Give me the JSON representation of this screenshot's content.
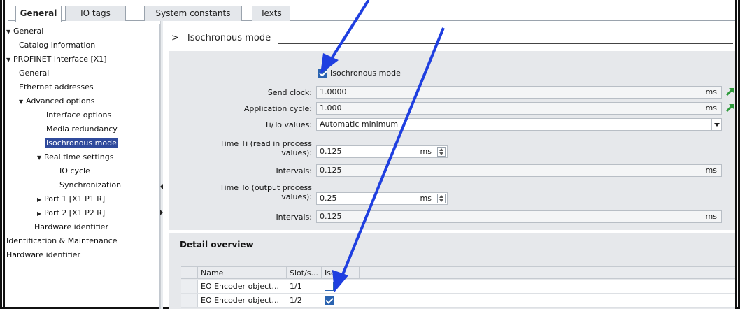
{
  "tabs": [
    {
      "label": "General",
      "active": true
    },
    {
      "label": "IO tags",
      "active": false
    },
    {
      "label": "System constants",
      "active": false
    },
    {
      "label": "Texts",
      "active": false
    }
  ],
  "nav": {
    "items": [
      {
        "label": "General",
        "expanded": true
      },
      {
        "label": "Catalog information"
      },
      {
        "label": "PROFINET interface [X1]",
        "expanded": true
      },
      {
        "label": "General"
      },
      {
        "label": "Ethernet addresses"
      },
      {
        "label": "Advanced options",
        "expanded": true
      },
      {
        "label": "Interface options"
      },
      {
        "label": "Media redundancy"
      },
      {
        "label": "Isochronous mode",
        "selected": true
      },
      {
        "label": "Real time settings",
        "expanded": true
      },
      {
        "label": "IO cycle"
      },
      {
        "label": "Synchronization"
      },
      {
        "label": "Port 1 [X1 P1 R]",
        "expanded": false
      },
      {
        "label": "Port 2 [X1 P2 R]",
        "expanded": false
      },
      {
        "label": "Hardware identifier"
      },
      {
        "label": "Identification & Maintenance"
      },
      {
        "label": "Hardware identifier"
      }
    ]
  },
  "section": {
    "chevron": ">",
    "title": "Isochronous mode"
  },
  "iso": {
    "checkbox_label": "Isochronous mode",
    "checked": true,
    "send_clock_label": "Send clock:",
    "send_clock_value": "1.0000",
    "send_clock_unit": "ms",
    "app_cycle_label": "Application cycle:",
    "app_cycle_value": "1.000",
    "app_cycle_unit": "ms",
    "tito_label": "Ti/To values:",
    "tito_value": "Automatic minimum",
    "ti_label_1": "Time Ti (read in process",
    "ti_label_2": "values):",
    "ti_value": "0.125",
    "ti_unit": "ms",
    "intervals_label": "Intervals:",
    "ti_intervals_value": "0.125",
    "ti_intervals_unit": "ms",
    "to_label_1": "Time To (output process",
    "to_label_2": "values):",
    "to_value": "0.25",
    "to_unit": "ms",
    "to_intervals_value": "0.125",
    "to_intervals_unit": "ms"
  },
  "detail": {
    "title": "Detail overview",
    "columns": [
      "Name",
      "Slot/s...",
      "Iso..."
    ],
    "rows": [
      {
        "name": "EO Encoder object...",
        "slot": "1/1",
        "iso": false
      },
      {
        "name": "EO Encoder object...",
        "slot": "1/2",
        "iso": true
      }
    ]
  },
  "colors": {
    "selection": "#2f4a9c",
    "checkbox": "#2a63b0",
    "annotation_arrow": "#1f3fe0",
    "link_arrow": "#2e9a3c"
  }
}
